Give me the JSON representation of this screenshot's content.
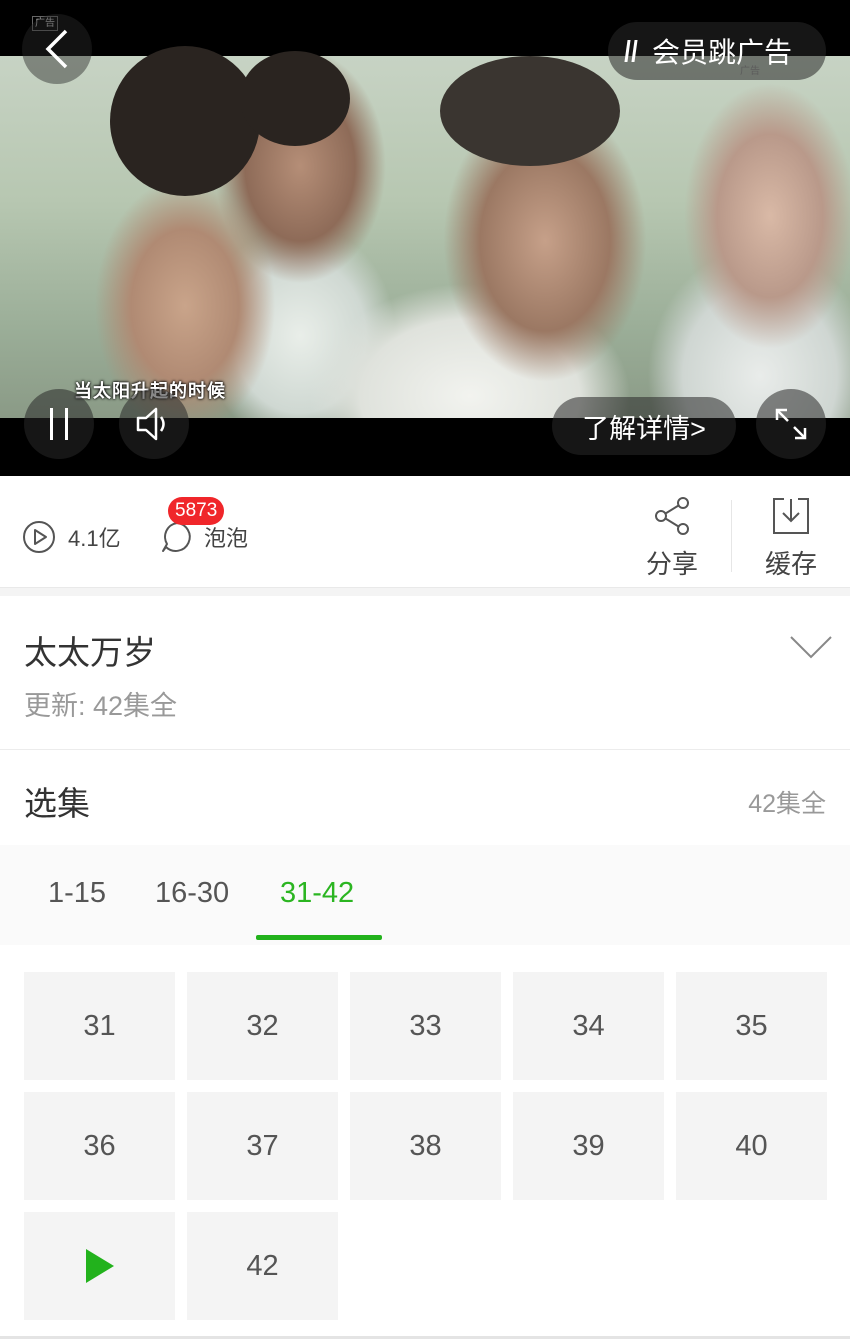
{
  "player": {
    "ad_tag": "广告",
    "ad_tag_corner": "广告",
    "skip_ad_label": "会员跳广告",
    "subtitle": "当太阳升起的时候",
    "learn_more_label": "了解详情>"
  },
  "stats": {
    "plays": "4.1亿",
    "bubble_badge": "5873",
    "bubble_label": "泡泡",
    "share_label": "分享",
    "cache_label": "缓存"
  },
  "show": {
    "title": "太太万岁",
    "update": "更新: 42集全"
  },
  "episodes": {
    "title": "选集",
    "count": "42集全",
    "ranges": [
      "1-15",
      "16-30",
      "31-42"
    ],
    "active_range": "31-42",
    "items": [
      "31",
      "32",
      "33",
      "34",
      "35",
      "36",
      "37",
      "38",
      "39",
      "40",
      "",
      "42"
    ],
    "playing_episode": "41"
  },
  "colors": {
    "accent_green": "#22b21c",
    "badge_red": "#f0262a",
    "cell_bg": "#f4f4f4"
  },
  "icons": [
    "back-arrow-icon",
    "pause-icon",
    "volume-icon",
    "fullscreen-icon",
    "play-count-icon",
    "bubble-icon",
    "share-icon",
    "download-icon",
    "chevron-down-icon",
    "play-icon"
  ]
}
